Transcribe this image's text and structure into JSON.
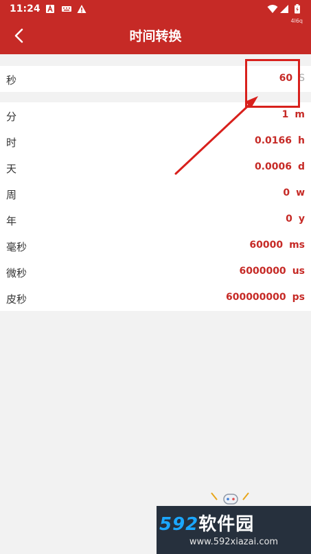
{
  "status_bar": {
    "time": "11:24",
    "net_speed": "4l6q",
    "icons": [
      "a-app-icon",
      "keyboard-icon",
      "warning-icon",
      "wifi-icon",
      "signal-icon",
      "battery-icon"
    ]
  },
  "header": {
    "title": "时间转换",
    "back_icon": "back-chevron-icon",
    "color": "#c62a26"
  },
  "input": {
    "label": "秒",
    "value": "60",
    "unit": "S"
  },
  "results": [
    {
      "label": "分",
      "value": "1",
      "unit": "m"
    },
    {
      "label": "时",
      "value": "0.0166",
      "unit": "h"
    },
    {
      "label": "天",
      "value": "0.0006",
      "unit": "d"
    },
    {
      "label": "周",
      "value": "0",
      "unit": "w"
    },
    {
      "label": "年",
      "value": "0",
      "unit": "y"
    },
    {
      "label": "毫秒",
      "value": "60000",
      "unit": "ms"
    },
    {
      "label": "微秒",
      "value": "6000000",
      "unit": "us"
    },
    {
      "label": "皮秒",
      "value": "600000000",
      "unit": "ps"
    }
  ],
  "watermark": {
    "brand_number": "592",
    "brand_text": "软件园",
    "url": "www.592xiazai.com"
  }
}
